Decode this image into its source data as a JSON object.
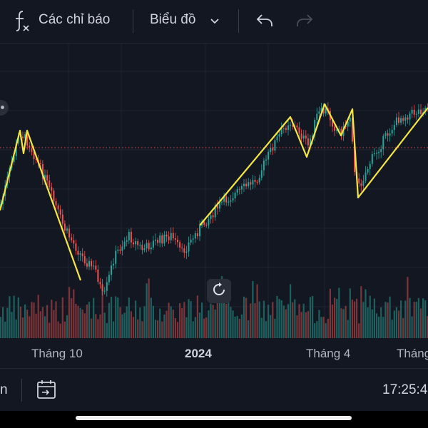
{
  "toolbar": {
    "indicators_label": "Các chỉ báo",
    "chart_type_label": "Biểu đồ"
  },
  "icons": {
    "indicators": "function-fx-icon",
    "chart_type_dropdown": "chevron-down-icon",
    "undo": "undo-icon",
    "redo": "redo-icon",
    "reset_chart": "reset-rotate-icon",
    "date_range": "calendar-goto-icon"
  },
  "colors": {
    "background": "#131722",
    "candle_up": "#26a69a",
    "candle_down": "#ef5350",
    "drawing_line": "#f5e642",
    "price_line": "#ef5350",
    "disabled_icon": "#4a4e5a"
  },
  "chart_data": {
    "type": "candlestick",
    "x_tick_labels": [
      "Tháng 10",
      "2024",
      "Tháng 4",
      "Tháng"
    ],
    "bold_tick": "2024",
    "grid": true,
    "volume_pane": true,
    "zigzag_drawing": true,
    "current_price_line": "dotted"
  },
  "bottom_bar": {
    "range_label_partial": "n",
    "time": "17:25:4"
  }
}
